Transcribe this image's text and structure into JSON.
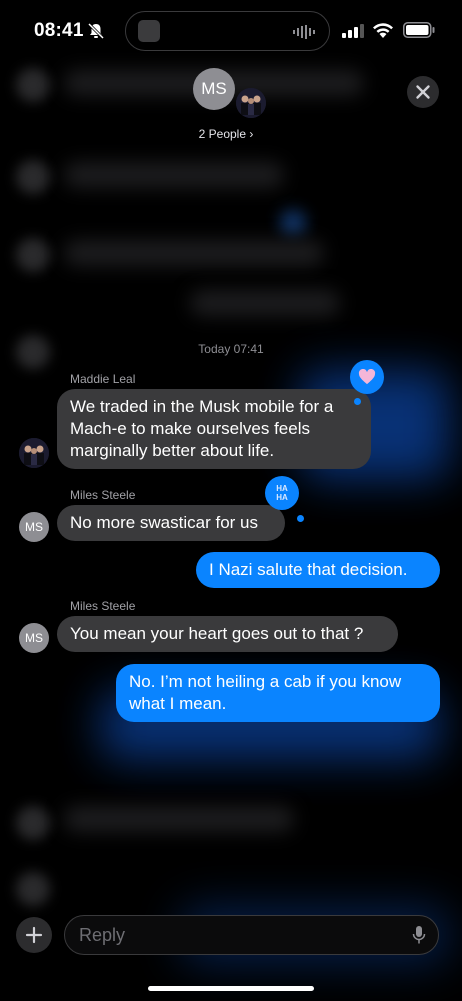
{
  "status_bar": {
    "time": "08:41"
  },
  "header": {
    "avatar_initials": "MS",
    "group_label": "2 People ›"
  },
  "conversation": {
    "timestamp": "Today 07:41",
    "messages": [
      {
        "sender": "Maddie Leal",
        "text": "We traded in the Musk mobile for a Mach-e to make ourselves feels marginally better about life.",
        "direction": "in",
        "tapback": "heart"
      },
      {
        "sender": "Miles Steele",
        "text": "No more swasticar for us",
        "direction": "in",
        "tapback": "haha",
        "tapback_label": "HA HA"
      },
      {
        "text": "I Nazi salute that decision.",
        "direction": "out"
      },
      {
        "sender": "Miles Steele",
        "text": "You mean your heart goes out to that ?",
        "direction": "in"
      },
      {
        "text": "No. I’m not heiling a cab if you know what I mean.",
        "direction": "out"
      }
    ],
    "avatar_initials": "MS"
  },
  "composer": {
    "placeholder": "Reply"
  },
  "colors": {
    "outgoing": "#0a84ff",
    "incoming": "#3a3a3c",
    "background": "#000000"
  }
}
